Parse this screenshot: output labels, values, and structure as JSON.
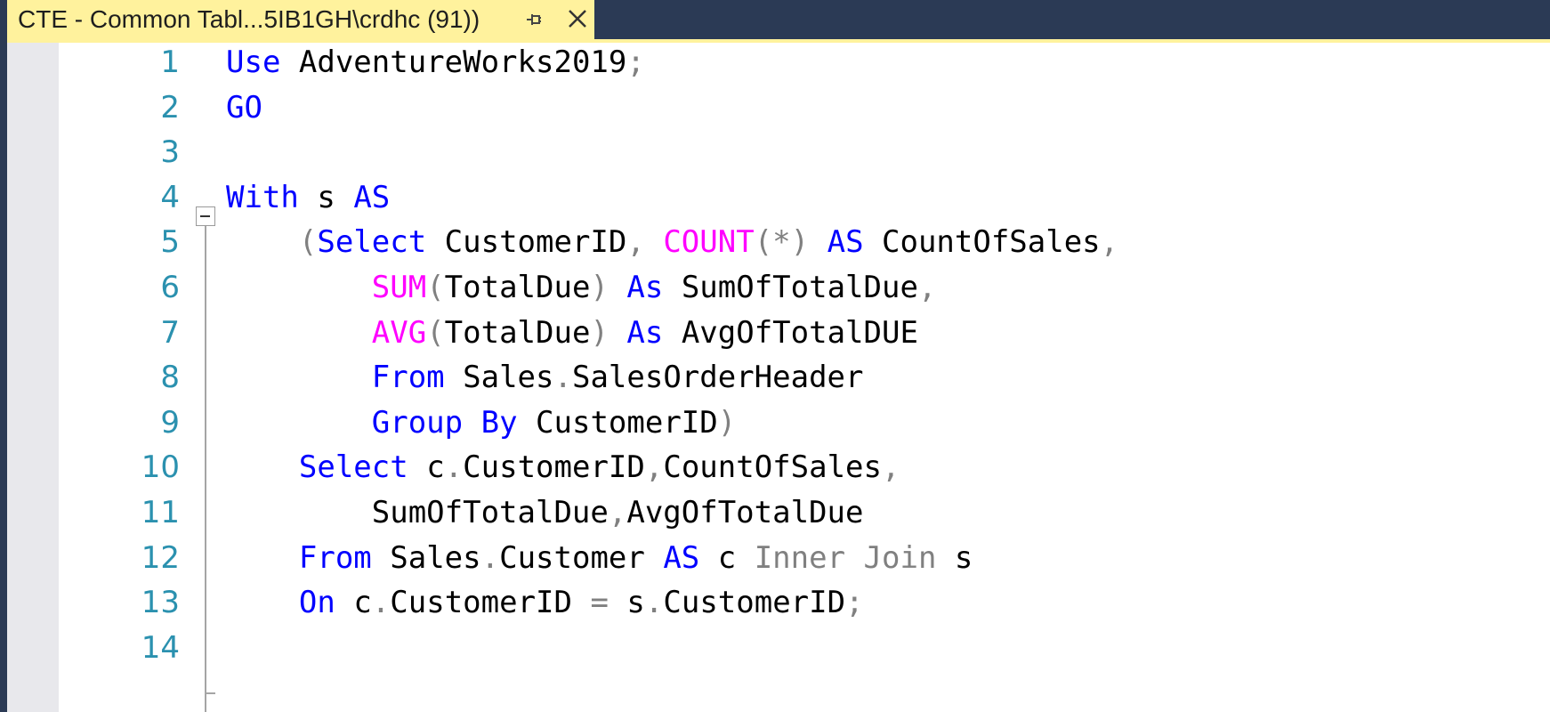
{
  "tab": {
    "title": "CTE - Common Tabl...5IB1GH\\crdhc (91))",
    "pin_icon": "pin-icon",
    "close_icon": "close-icon"
  },
  "colors": {
    "tab_active": "#fff29d",
    "frame": "#2b3a55",
    "line_number": "#2b91af",
    "keyword": "#0000ff",
    "function": "#ff00ff",
    "operator": "#808080",
    "identifier": "#000000"
  },
  "line_numbers": [
    "1",
    "2",
    "3",
    "4",
    "5",
    "6",
    "7",
    "8",
    "9",
    "10",
    "11",
    "12",
    "13",
    "14"
  ],
  "code_lines": [
    [
      {
        "t": "Use",
        "c": "kw"
      },
      {
        "t": " AdventureWorks2019",
        "c": "id"
      },
      {
        "t": ";",
        "c": "op"
      }
    ],
    [
      {
        "t": "GO",
        "c": "kw"
      }
    ],
    [],
    [
      {
        "t": "With",
        "c": "kw"
      },
      {
        "t": " s ",
        "c": "id"
      },
      {
        "t": "AS",
        "c": "kw"
      }
    ],
    [
      {
        "t": "    ",
        "c": "id"
      },
      {
        "t": "(",
        "c": "op"
      },
      {
        "t": "Select",
        "c": "kw"
      },
      {
        "t": " CustomerID",
        "c": "id"
      },
      {
        "t": ", ",
        "c": "op"
      },
      {
        "t": "COUNT",
        "c": "fn"
      },
      {
        "t": "(*)",
        "c": "op"
      },
      {
        "t": " ",
        "c": "id"
      },
      {
        "t": "AS",
        "c": "kw"
      },
      {
        "t": " CountOfSales",
        "c": "id"
      },
      {
        "t": ",",
        "c": "op"
      }
    ],
    [
      {
        "t": "        ",
        "c": "id"
      },
      {
        "t": "SUM",
        "c": "fn"
      },
      {
        "t": "(",
        "c": "op"
      },
      {
        "t": "TotalDue",
        "c": "id"
      },
      {
        "t": ")",
        "c": "op"
      },
      {
        "t": " ",
        "c": "id"
      },
      {
        "t": "As",
        "c": "kw"
      },
      {
        "t": " SumOfTotalDue",
        "c": "id"
      },
      {
        "t": ",",
        "c": "op"
      }
    ],
    [
      {
        "t": "        ",
        "c": "id"
      },
      {
        "t": "AVG",
        "c": "fn"
      },
      {
        "t": "(",
        "c": "op"
      },
      {
        "t": "TotalDue",
        "c": "id"
      },
      {
        "t": ")",
        "c": "op"
      },
      {
        "t": " ",
        "c": "id"
      },
      {
        "t": "As",
        "c": "kw"
      },
      {
        "t": " AvgOfTotalDUE",
        "c": "id"
      }
    ],
    [
      {
        "t": "        ",
        "c": "id"
      },
      {
        "t": "From",
        "c": "kw"
      },
      {
        "t": " Sales",
        "c": "id"
      },
      {
        "t": ".",
        "c": "op"
      },
      {
        "t": "SalesOrderHeader",
        "c": "id"
      }
    ],
    [
      {
        "t": "        ",
        "c": "id"
      },
      {
        "t": "Group",
        "c": "kw"
      },
      {
        "t": " ",
        "c": "id"
      },
      {
        "t": "By",
        "c": "kw"
      },
      {
        "t": " CustomerID",
        "c": "id"
      },
      {
        "t": ")",
        "c": "op"
      }
    ],
    [
      {
        "t": "    ",
        "c": "id"
      },
      {
        "t": "Select",
        "c": "kw"
      },
      {
        "t": " c",
        "c": "id"
      },
      {
        "t": ".",
        "c": "op"
      },
      {
        "t": "CustomerID",
        "c": "id"
      },
      {
        "t": ",",
        "c": "op"
      },
      {
        "t": "CountOfSales",
        "c": "id"
      },
      {
        "t": ",",
        "c": "op"
      }
    ],
    [
      {
        "t": "        SumOfTotalDue",
        "c": "id"
      },
      {
        "t": ",",
        "c": "op"
      },
      {
        "t": "AvgOfTotalDue",
        "c": "id"
      }
    ],
    [
      {
        "t": "    ",
        "c": "id"
      },
      {
        "t": "From",
        "c": "kw"
      },
      {
        "t": " Sales",
        "c": "id"
      },
      {
        "t": ".",
        "c": "op"
      },
      {
        "t": "Customer ",
        "c": "id"
      },
      {
        "t": "AS",
        "c": "kw"
      },
      {
        "t": " c ",
        "c": "id"
      },
      {
        "t": "Inner",
        "c": "op"
      },
      {
        "t": " ",
        "c": "id"
      },
      {
        "t": "Join",
        "c": "op"
      },
      {
        "t": " s",
        "c": "id"
      }
    ],
    [
      {
        "t": "    ",
        "c": "id"
      },
      {
        "t": "On",
        "c": "kw"
      },
      {
        "t": " c",
        "c": "id"
      },
      {
        "t": ".",
        "c": "op"
      },
      {
        "t": "CustomerID ",
        "c": "id"
      },
      {
        "t": "=",
        "c": "op"
      },
      {
        "t": " s",
        "c": "id"
      },
      {
        "t": ".",
        "c": "op"
      },
      {
        "t": "CustomerID",
        "c": "id"
      },
      {
        "t": ";",
        "c": "op"
      }
    ],
    []
  ]
}
